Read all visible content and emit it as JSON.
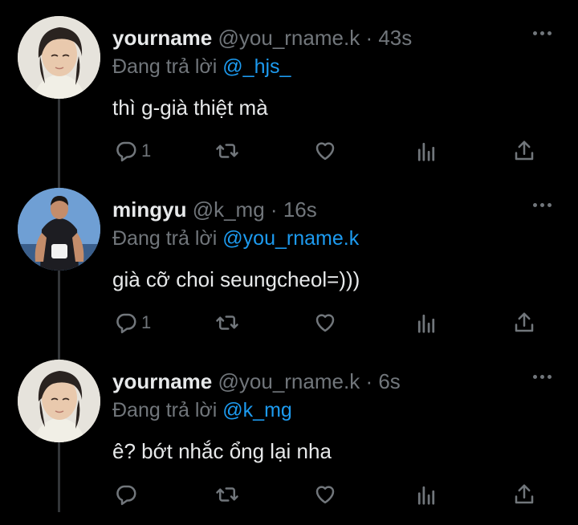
{
  "colors": {
    "background": "#000000",
    "text": "#e7e9ea",
    "muted": "#71767b",
    "mention": "#1d9bf0"
  },
  "tweets": [
    {
      "name": "yourname",
      "handle": "@you_rname.k",
      "separator": "·",
      "time": "43s",
      "reply_prefix": "Đang trả lời",
      "reply_to": "@_hjs_",
      "text": "thì g-già thiệt mà",
      "reply_count": "1",
      "icons": [
        "reply-icon",
        "retweet-icon",
        "like-icon",
        "views-icon",
        "share-icon"
      ]
    },
    {
      "name": "mingyu",
      "handle": "@k_mg",
      "separator": "·",
      "time": "16s",
      "reply_prefix": "Đang trả lời",
      "reply_to": "@you_rname.k",
      "text": "già cỡ choi seungcheol=)))",
      "reply_count": "1",
      "icons": [
        "reply-icon",
        "retweet-icon",
        "like-icon",
        "views-icon",
        "share-icon"
      ]
    },
    {
      "name": "yourname",
      "handle": "@you_rname.k",
      "separator": "·",
      "time": "6s",
      "reply_prefix": "Đang trả lời",
      "reply_to": "@k_mg",
      "text": "ê? bớt nhắc ổng lại nha",
      "reply_count": "",
      "icons": [
        "reply-icon",
        "retweet-icon",
        "like-icon",
        "views-icon",
        "share-icon"
      ]
    }
  ]
}
